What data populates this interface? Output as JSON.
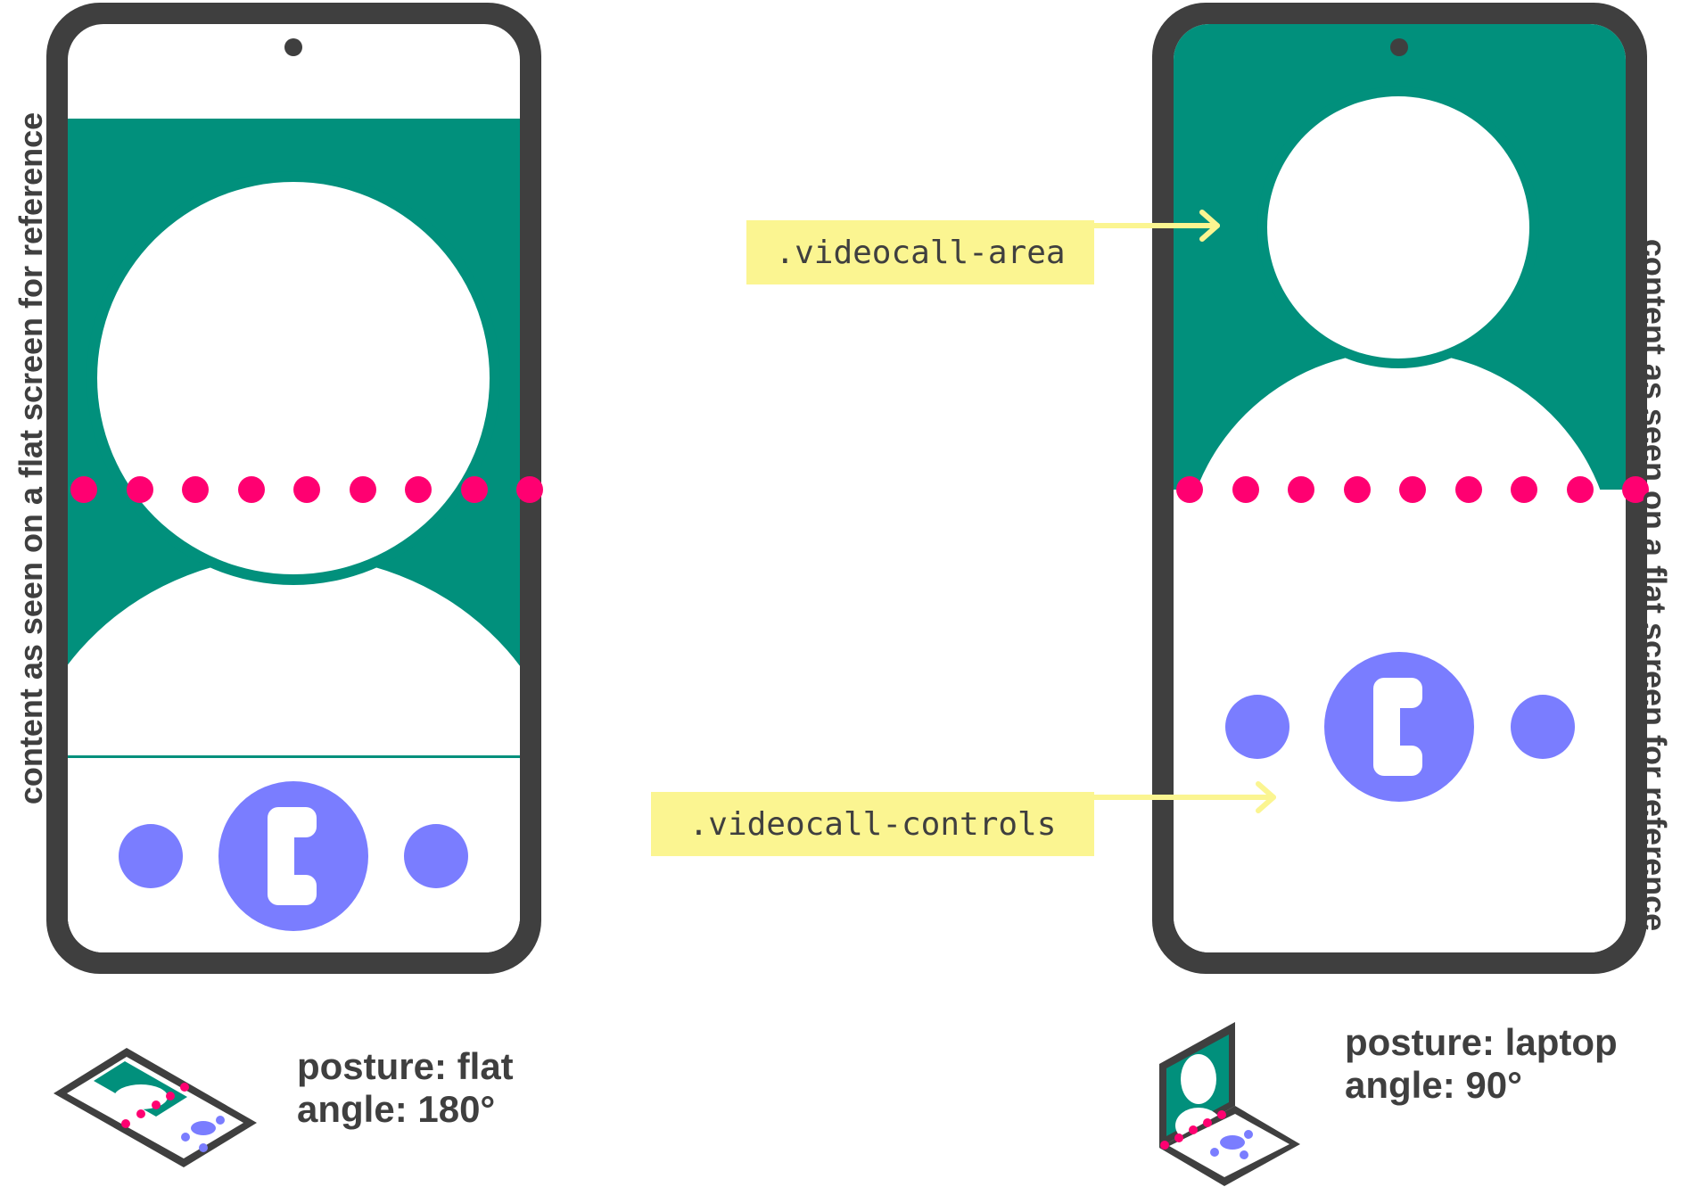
{
  "side_label": "content as seen on a flat screen for reference",
  "labels": {
    "videocall_area": ".videocall-area",
    "videocall_controls": ".videocall-controls"
  },
  "postures": {
    "flat": {
      "posture": "posture: flat",
      "angle": "angle: 180°"
    },
    "laptop": {
      "posture": "posture: laptop",
      "angle": "angle: 90°"
    }
  },
  "colors": {
    "teal": "#01907c",
    "fold_dots": "#ff0071",
    "controls": "#7a7dff",
    "frame": "#3f3f3f",
    "label_bg": "#fbf591",
    "arrow": "#fbf591"
  },
  "icons": {
    "call_button": "phone-icon",
    "avatar": "person-avatar",
    "fold_line": "dotted-hinge-line"
  }
}
